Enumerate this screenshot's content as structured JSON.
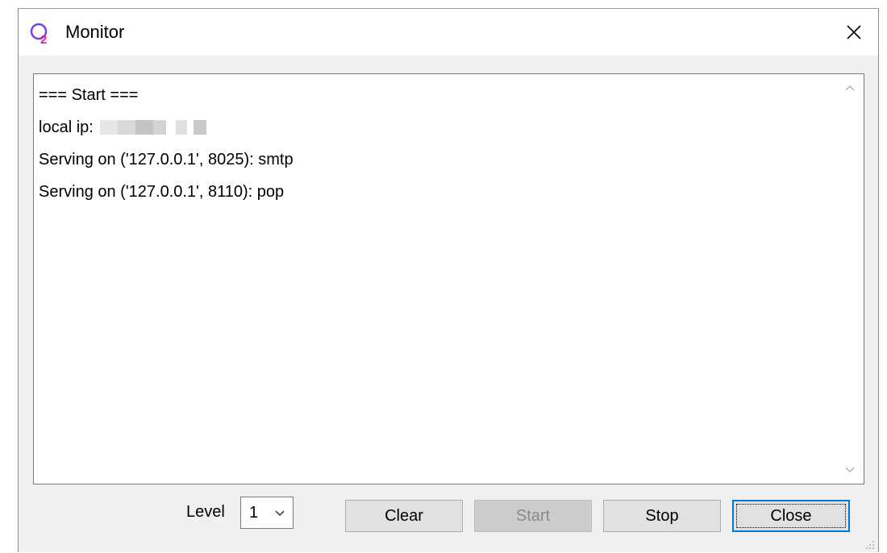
{
  "window": {
    "title": "Monitor",
    "app_icon": "q2-app-icon",
    "close_icon": "close-icon"
  },
  "log": {
    "lines": [
      "=== Start ===",
      "local ip:",
      "Serving on ('127.0.0.1', 8025): smtp",
      "Serving on ('127.0.0.1', 8110): pop"
    ]
  },
  "controls": {
    "level_label": "Level",
    "level_value": "1",
    "clear_label": "Clear",
    "start_label": "Start",
    "stop_label": "Stop",
    "close_label": "Close"
  },
  "colors": {
    "focus_border": "#0078d7",
    "icon_purple": "#7b3fe4",
    "icon_pink": "#e0218a"
  }
}
